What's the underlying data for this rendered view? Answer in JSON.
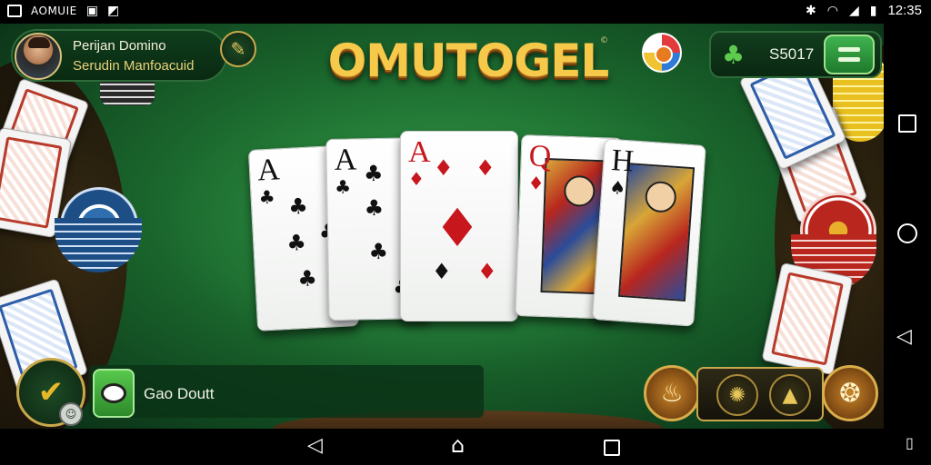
{
  "status_bar": {
    "left_text": "AOMUIE",
    "time": "12:35"
  },
  "player": {
    "name": "Perijan Domino",
    "subtitle": "Serudin Manfoacuid",
    "avatar_icon": "player-avatar",
    "edit_icon": "pencil-icon"
  },
  "logo": {
    "title": "OMUTOGEL",
    "tm": "©"
  },
  "header_right": {
    "chips_value": "S5017",
    "chips_icon": "clover-icon",
    "menu_icon": "menu-icon"
  },
  "cards": [
    {
      "rank": "A",
      "suit": "♣",
      "color": "black"
    },
    {
      "rank": "A",
      "suit": "♣",
      "color": "black"
    },
    {
      "rank": "A",
      "suit": "♦",
      "color": "red"
    },
    {
      "rank": "Q",
      "suit": "♦",
      "color": "red"
    },
    {
      "rank": "H",
      "suit": "♠",
      "color": "black"
    }
  ],
  "chat": {
    "text": "Gao Doutt"
  },
  "colors": {
    "felt": "#1d6d30",
    "gold": "#c9a84c",
    "button_green": "#3fb34f"
  }
}
